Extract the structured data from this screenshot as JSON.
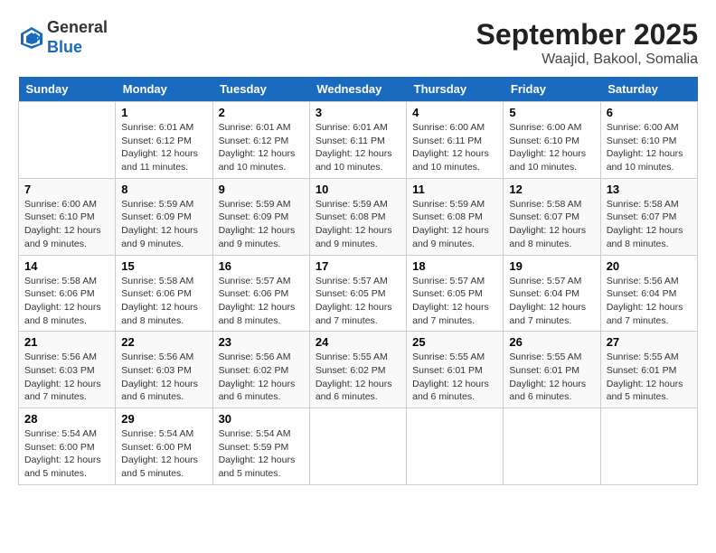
{
  "header": {
    "logo": {
      "line1": "General",
      "line2": "Blue"
    },
    "title": "September 2025",
    "subtitle": "Waajid, Bakool, Somalia"
  },
  "days_of_week": [
    "Sunday",
    "Monday",
    "Tuesday",
    "Wednesday",
    "Thursday",
    "Friday",
    "Saturday"
  ],
  "weeks": [
    [
      {
        "date": "",
        "info": ""
      },
      {
        "date": "1",
        "info": "Sunrise: 6:01 AM\nSunset: 6:12 PM\nDaylight: 12 hours\nand 11 minutes."
      },
      {
        "date": "2",
        "info": "Sunrise: 6:01 AM\nSunset: 6:12 PM\nDaylight: 12 hours\nand 10 minutes."
      },
      {
        "date": "3",
        "info": "Sunrise: 6:01 AM\nSunset: 6:11 PM\nDaylight: 12 hours\nand 10 minutes."
      },
      {
        "date": "4",
        "info": "Sunrise: 6:00 AM\nSunset: 6:11 PM\nDaylight: 12 hours\nand 10 minutes."
      },
      {
        "date": "5",
        "info": "Sunrise: 6:00 AM\nSunset: 6:10 PM\nDaylight: 12 hours\nand 10 minutes."
      },
      {
        "date": "6",
        "info": "Sunrise: 6:00 AM\nSunset: 6:10 PM\nDaylight: 12 hours\nand 10 minutes."
      }
    ],
    [
      {
        "date": "7",
        "info": "Sunrise: 6:00 AM\nSunset: 6:10 PM\nDaylight: 12 hours\nand 9 minutes."
      },
      {
        "date": "8",
        "info": "Sunrise: 5:59 AM\nSunset: 6:09 PM\nDaylight: 12 hours\nand 9 minutes."
      },
      {
        "date": "9",
        "info": "Sunrise: 5:59 AM\nSunset: 6:09 PM\nDaylight: 12 hours\nand 9 minutes."
      },
      {
        "date": "10",
        "info": "Sunrise: 5:59 AM\nSunset: 6:08 PM\nDaylight: 12 hours\nand 9 minutes."
      },
      {
        "date": "11",
        "info": "Sunrise: 5:59 AM\nSunset: 6:08 PM\nDaylight: 12 hours\nand 9 minutes."
      },
      {
        "date": "12",
        "info": "Sunrise: 5:58 AM\nSunset: 6:07 PM\nDaylight: 12 hours\nand 8 minutes."
      },
      {
        "date": "13",
        "info": "Sunrise: 5:58 AM\nSunset: 6:07 PM\nDaylight: 12 hours\nand 8 minutes."
      }
    ],
    [
      {
        "date": "14",
        "info": "Sunrise: 5:58 AM\nSunset: 6:06 PM\nDaylight: 12 hours\nand 8 minutes."
      },
      {
        "date": "15",
        "info": "Sunrise: 5:58 AM\nSunset: 6:06 PM\nDaylight: 12 hours\nand 8 minutes."
      },
      {
        "date": "16",
        "info": "Sunrise: 5:57 AM\nSunset: 6:06 PM\nDaylight: 12 hours\nand 8 minutes."
      },
      {
        "date": "17",
        "info": "Sunrise: 5:57 AM\nSunset: 6:05 PM\nDaylight: 12 hours\nand 7 minutes."
      },
      {
        "date": "18",
        "info": "Sunrise: 5:57 AM\nSunset: 6:05 PM\nDaylight: 12 hours\nand 7 minutes."
      },
      {
        "date": "19",
        "info": "Sunrise: 5:57 AM\nSunset: 6:04 PM\nDaylight: 12 hours\nand 7 minutes."
      },
      {
        "date": "20",
        "info": "Sunrise: 5:56 AM\nSunset: 6:04 PM\nDaylight: 12 hours\nand 7 minutes."
      }
    ],
    [
      {
        "date": "21",
        "info": "Sunrise: 5:56 AM\nSunset: 6:03 PM\nDaylight: 12 hours\nand 7 minutes."
      },
      {
        "date": "22",
        "info": "Sunrise: 5:56 AM\nSunset: 6:03 PM\nDaylight: 12 hours\nand 6 minutes."
      },
      {
        "date": "23",
        "info": "Sunrise: 5:56 AM\nSunset: 6:02 PM\nDaylight: 12 hours\nand 6 minutes."
      },
      {
        "date": "24",
        "info": "Sunrise: 5:55 AM\nSunset: 6:02 PM\nDaylight: 12 hours\nand 6 minutes."
      },
      {
        "date": "25",
        "info": "Sunrise: 5:55 AM\nSunset: 6:01 PM\nDaylight: 12 hours\nand 6 minutes."
      },
      {
        "date": "26",
        "info": "Sunrise: 5:55 AM\nSunset: 6:01 PM\nDaylight: 12 hours\nand 6 minutes."
      },
      {
        "date": "27",
        "info": "Sunrise: 5:55 AM\nSunset: 6:01 PM\nDaylight: 12 hours\nand 5 minutes."
      }
    ],
    [
      {
        "date": "28",
        "info": "Sunrise: 5:54 AM\nSunset: 6:00 PM\nDaylight: 12 hours\nand 5 minutes."
      },
      {
        "date": "29",
        "info": "Sunrise: 5:54 AM\nSunset: 6:00 PM\nDaylight: 12 hours\nand 5 minutes."
      },
      {
        "date": "30",
        "info": "Sunrise: 5:54 AM\nSunset: 5:59 PM\nDaylight: 12 hours\nand 5 minutes."
      },
      {
        "date": "",
        "info": ""
      },
      {
        "date": "",
        "info": ""
      },
      {
        "date": "",
        "info": ""
      },
      {
        "date": "",
        "info": ""
      }
    ]
  ]
}
